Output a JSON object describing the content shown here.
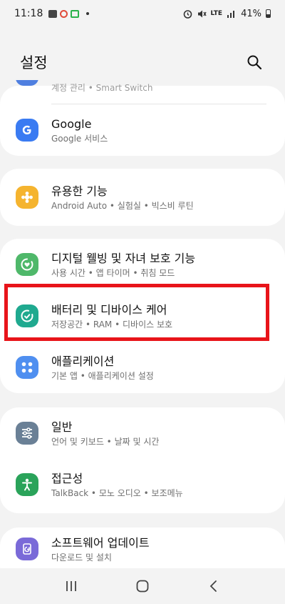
{
  "status_bar": {
    "time": "11:18",
    "network": "LTE",
    "battery": "41%"
  },
  "header": {
    "title": "설정",
    "search_icon": "search-icon"
  },
  "colors": {
    "highlight": "#e8141a",
    "google_icon": "#3a7bf2",
    "advanced_icon": "#f5b42f",
    "wellbeing_icon": "#4fb86a",
    "battery_icon": "#1fa98f",
    "apps_icon": "#4f8ff0",
    "general_icon": "#6a8096",
    "accessibility_icon": "#2aa35a",
    "update_icon": "#7a6ad8"
  },
  "settings": {
    "accounts_partial": {
      "subtitle": "계정 관리 • Smart Switch"
    },
    "google": {
      "title": "Google",
      "subtitle": "Google 서비스",
      "icon": "google-icon"
    },
    "advanced": {
      "title": "유용한 기능",
      "subtitle": "Android Auto • 실험실 • 빅스비 루틴",
      "icon": "puzzle-icon"
    },
    "wellbeing": {
      "title": "디지털 웰빙 및 자녀 보호 기능",
      "subtitle": "사용 시간 • 앱 타이머 • 취침 모드",
      "icon": "wellbeing-icon"
    },
    "battery_care": {
      "title": "배터리 및 디바이스 케어",
      "subtitle": "저장공간 • RAM • 디바이스 보호",
      "icon": "device-care-icon"
    },
    "apps": {
      "title": "애플리케이션",
      "subtitle": "기본 앱 • 애플리케이션 설정",
      "icon": "apps-grid-icon"
    },
    "general": {
      "title": "일반",
      "subtitle": "언어 및 키보드 • 날짜 및 시간",
      "icon": "sliders-icon"
    },
    "accessibility": {
      "title": "접근성",
      "subtitle": "TalkBack • 모노 오디오 • 보조메뉴",
      "icon": "accessibility-icon"
    },
    "software_update": {
      "title": "소프트웨어 업데이트",
      "subtitle": "다운로드 및 설치",
      "icon": "update-icon"
    }
  },
  "nav_bar": {
    "recents": "recents-icon",
    "home": "home-icon",
    "back": "back-icon"
  }
}
